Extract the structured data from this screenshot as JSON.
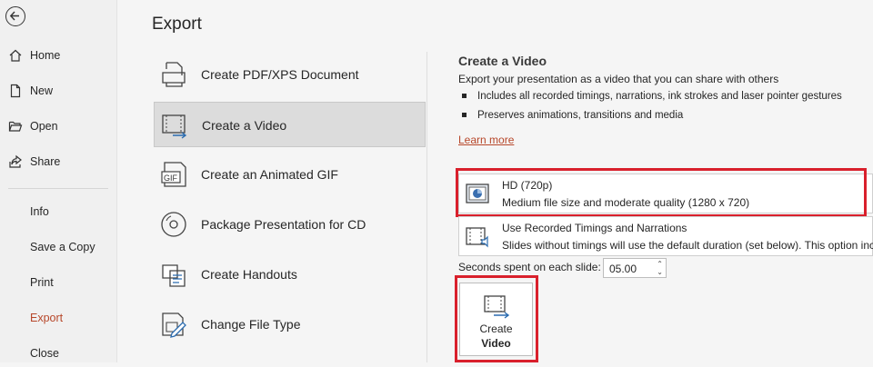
{
  "sidebar": {
    "items": [
      {
        "label": "Home"
      },
      {
        "label": "New"
      },
      {
        "label": "Open"
      },
      {
        "label": "Share"
      },
      {
        "label": "Info"
      },
      {
        "label": "Save a Copy"
      },
      {
        "label": "Print"
      },
      {
        "label": "Export"
      },
      {
        "label": "Close"
      }
    ],
    "active": "Export",
    "active_color": "#b7472a"
  },
  "main": {
    "title": "Export",
    "options": [
      {
        "label": "Create PDF/XPS Document",
        "icon": "pdf-document-icon"
      },
      {
        "label": "Create a Video",
        "icon": "video-icon",
        "selected": true
      },
      {
        "label": "Create an Animated GIF",
        "icon": "gif-icon"
      },
      {
        "label": "Package Presentation for CD",
        "icon": "cd-icon"
      },
      {
        "label": "Create Handouts",
        "icon": "handouts-icon"
      },
      {
        "label": "Change File Type",
        "icon": "change-file-type-icon"
      }
    ]
  },
  "pane": {
    "heading": "Create a Video",
    "description": "Export your presentation as a video that you can share with others",
    "bullets": [
      "Includes all recorded timings, narrations, ink strokes and laser pointer gestures",
      "Preserves animations, transitions and media"
    ],
    "learn_more": "Learn more",
    "quality": {
      "title": "HD (720p)",
      "subtitle": "Medium file size and moderate quality (1280 x 720)"
    },
    "timings": {
      "title": "Use Recorded Timings and Narrations",
      "subtitle": "Slides without timings will use the default duration (set below). This option incl"
    },
    "seconds_label": "Seconds spent on each slide:",
    "seconds_value": "05.00",
    "create_button": {
      "line1": "Create",
      "line2": "Video"
    },
    "highlight_color": "#d9202c"
  }
}
